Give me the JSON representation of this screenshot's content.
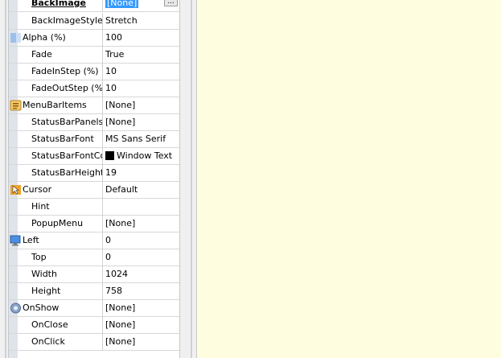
{
  "inspector": {
    "top_row": {
      "name": "BackImage",
      "value": "[None]",
      "button": "..."
    },
    "rows": [
      {
        "name": "BackImageStyle",
        "value": "Stretch",
        "icon": ""
      },
      {
        "name": "Alpha (%)",
        "value": "100",
        "icon": "alpha-icon"
      },
      {
        "name": "Fade",
        "value": "True",
        "icon": ""
      },
      {
        "name": "FadeInStep (%)",
        "value": "10",
        "icon": ""
      },
      {
        "name": "FadeOutStep (%)",
        "value": "10",
        "icon": ""
      },
      {
        "name": "MenuBarItems",
        "value": "[None]",
        "icon": "menu-icon"
      },
      {
        "name": "StatusBarPanels",
        "value": "[None]",
        "icon": ""
      },
      {
        "name": "StatusBarFont",
        "value": "MS Sans Serif",
        "icon": ""
      },
      {
        "name": "StatusBarFontColor",
        "value": "Window Text",
        "icon": "",
        "swatch": "#000000"
      },
      {
        "name": "StatusBarHeight",
        "value": "19",
        "icon": ""
      },
      {
        "name": "Cursor",
        "value": "Default",
        "icon": "cursor-icon"
      },
      {
        "name": "Hint",
        "value": "",
        "icon": ""
      },
      {
        "name": "PopupMenu",
        "value": "[None]",
        "icon": ""
      },
      {
        "name": "Left",
        "value": "0",
        "icon": "position-icon"
      },
      {
        "name": "Top",
        "value": "0",
        "icon": ""
      },
      {
        "name": "Width",
        "value": "1024",
        "icon": ""
      },
      {
        "name": "Height",
        "value": "758",
        "icon": ""
      },
      {
        "name": "OnShow",
        "value": "[None]",
        "icon": "event-icon"
      },
      {
        "name": "OnClose",
        "value": "[None]",
        "icon": ""
      },
      {
        "name": "OnClick",
        "value": "[None]",
        "icon": ""
      }
    ]
  },
  "colors": {
    "canvas": "#fffde0",
    "selection": "#3399ff",
    "gutter": "#dfe3ea"
  }
}
